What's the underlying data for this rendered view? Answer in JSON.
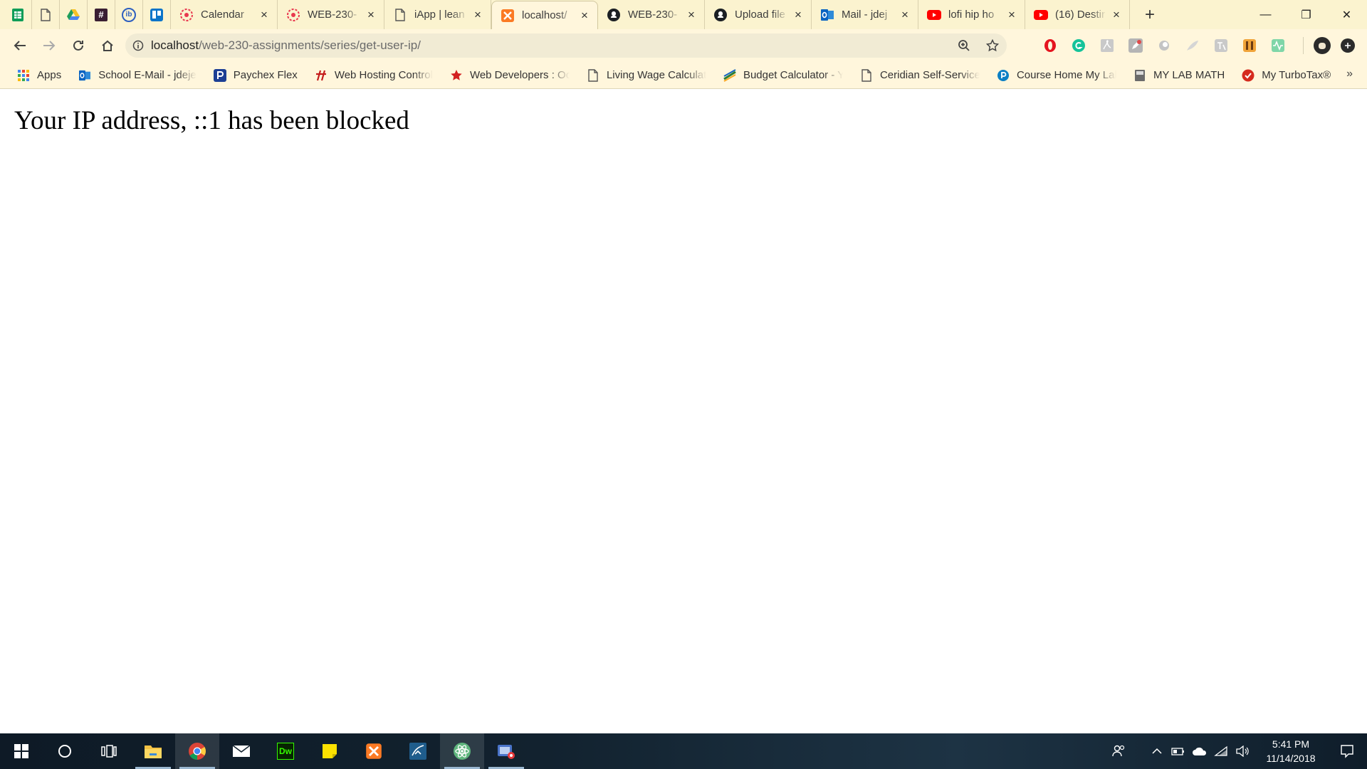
{
  "tabstrip": {
    "pinned": [
      {
        "icon": "sheets-icon"
      },
      {
        "icon": "document-icon"
      },
      {
        "icon": "drive-icon"
      },
      {
        "icon": "hash-icon",
        "glyph": "#"
      },
      {
        "icon": "ib-icon",
        "glyph": "ib"
      },
      {
        "icon": "trello-icon"
      }
    ],
    "tabs": [
      {
        "title": "Calendar",
        "icon": "asana-icon"
      },
      {
        "title": "WEB-230-",
        "icon": "asana-icon"
      },
      {
        "title": "iApp | lean",
        "icon": "document-icon"
      },
      {
        "title": "localhost/",
        "icon": "xampp-icon",
        "active": true
      },
      {
        "title": "WEB-230-",
        "icon": "github-icon"
      },
      {
        "title": "Upload file",
        "icon": "github-icon"
      },
      {
        "title": "Mail - jdej",
        "icon": "outlook-icon"
      },
      {
        "title": "lofi hip ho",
        "icon": "youtube-icon"
      },
      {
        "title": "(16) Destir",
        "icon": "youtube-icon"
      }
    ],
    "close_glyph": "×",
    "new_tab_glyph": "+",
    "window_controls": {
      "minimize": "—",
      "restore": "❐",
      "close": "✕"
    }
  },
  "toolbar": {
    "url_host": "localhost",
    "url_path": "/web-230-assignments/series/get-user-ip/"
  },
  "bookmarks": [
    {
      "label": "Apps",
      "icon": "apps-grid-icon"
    },
    {
      "label": "School E-Mail - jdeje",
      "icon": "outlook-icon"
    },
    {
      "label": "Paychex Flex",
      "icon": "paychex-icon"
    },
    {
      "label": "Web Hosting Control",
      "icon": "hosting-icon"
    },
    {
      "label": "Web Developers : Oc",
      "icon": "star-icon"
    },
    {
      "label": "Living Wage Calculat",
      "icon": "document-icon"
    },
    {
      "label": "Budget Calculator - Y",
      "icon": "budget-icon"
    },
    {
      "label": "Ceridian Self-Service",
      "icon": "document-icon"
    },
    {
      "label": "Course Home My Lab",
      "icon": "pearson-icon"
    },
    {
      "label": "MY LAB MATH",
      "icon": "mylab-icon"
    },
    {
      "label": "My TurboTax®",
      "icon": "turbotax-icon"
    }
  ],
  "bookmarks_more": "»",
  "page": {
    "message": "Your IP address, ::1 has been blocked"
  },
  "taskbar": {
    "time": "5:41 PM",
    "date": "11/14/2018"
  },
  "colors": {
    "tabstrip_bg": "#fbf3cf",
    "toolbar_bg": "#fff6dc",
    "taskbar_bg": "#12222f"
  }
}
